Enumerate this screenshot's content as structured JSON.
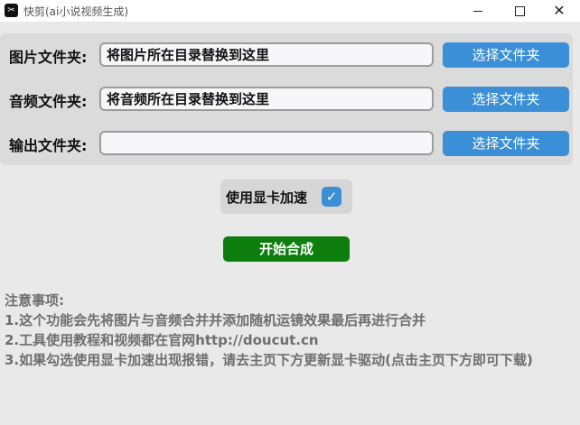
{
  "window": {
    "app_icon": "app-logo-icon",
    "title": "快剪(ai小说视频生成)",
    "controls": {
      "minimize_icon": "minimize-icon",
      "maximize_icon": "maximize-icon",
      "close_icon": "close-icon"
    }
  },
  "form": {
    "rows": [
      {
        "label": "图片文件夹:",
        "value": "将图片所在目录替换到这里",
        "button": "选择文件夹"
      },
      {
        "label": "音频文件夹:",
        "value": "将音频所在目录替换到这里",
        "button": "选择文件夹"
      },
      {
        "label": "输出文件夹:",
        "value": "",
        "button": "选择文件夹"
      }
    ]
  },
  "gpu": {
    "label": "使用显卡加速",
    "checked": true,
    "check_icon": "checkmark-icon",
    "check_glyph": "✓"
  },
  "start_button": "开始合成",
  "notes": {
    "heading": "注意事项:",
    "items": [
      "1.这个功能会先将图片与音频合并并添加随机运镜效果最后再进行合并",
      "2.工具使用教程和视频都在官网http://doucut.cn",
      "3.如果勾选使用显卡加速出现报错，请去主页下方更新显卡驱动(点击主页下方即可下载)"
    ]
  },
  "colors": {
    "accent_blue": "#3a8fd6",
    "start_green": "#0d7e0d",
    "background": "#e9e9e9",
    "panel": "#dbdbdb",
    "notes_text": "#6e6e6e"
  }
}
